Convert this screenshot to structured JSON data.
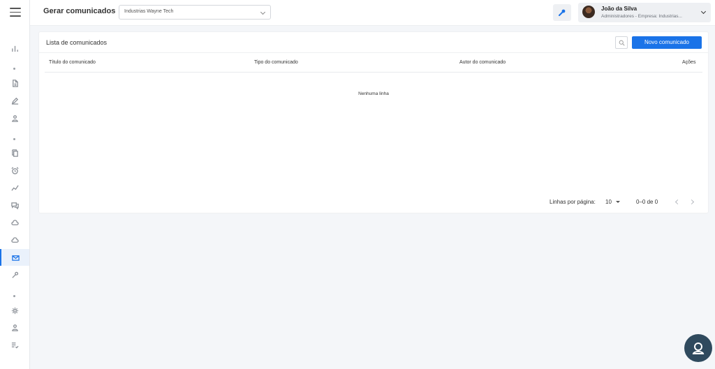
{
  "header": {
    "title": "Gerar comunicados",
    "company_select": "Industrias Wayne Tech",
    "user": {
      "name": "João da Silva",
      "role": "Administradores - Empresa: Industrias..."
    }
  },
  "card": {
    "title": "Lista de comunicados",
    "new_button": "Novo comunicado",
    "columns": [
      "Título do comunicado",
      "Tipo do comunicado",
      "Autor do comunicado",
      "Ações"
    ],
    "empty_message": "Nenhuma linha",
    "pagination": {
      "rows_label": "Linhas por página:",
      "rows_per_page": "10",
      "range": "0–0 de 0"
    }
  },
  "sidebar": {
    "icons": [
      "bar-chart-icon",
      "document-icon",
      "pen-icon",
      "person-icon",
      "copy-icon",
      "alarm-icon",
      "trend-icon",
      "chat-icon",
      "cloud-icon",
      "cloud-icon",
      "mail-icon",
      "wrench-icon",
      "gear-icon",
      "person-icon",
      "list-check-icon"
    ],
    "active": "mail-icon"
  },
  "colors": {
    "accent": "#1a73e8",
    "background": "#f4f6f9",
    "fab": "#2f4a5e"
  }
}
